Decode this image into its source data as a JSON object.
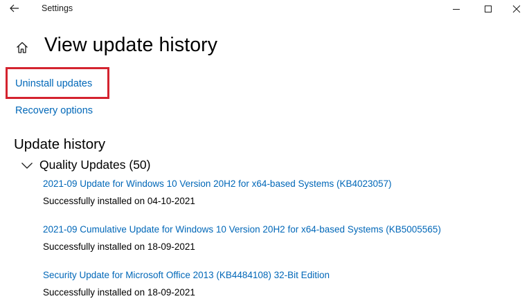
{
  "window": {
    "title": "Settings",
    "controls": {
      "minimize_icon": "minimize-icon",
      "maximize_icon": "maximize-icon",
      "close_icon": "close-icon"
    }
  },
  "header": {
    "title": "View update history",
    "home_icon": "home-icon"
  },
  "links": {
    "uninstall": "Uninstall updates",
    "recovery": "Recovery options"
  },
  "history": {
    "section_title": "Update history",
    "group": {
      "title": "Quality Updates (50)",
      "expanded": true,
      "items": [
        {
          "name": "2021-09 Update for Windows 10 Version 20H2 for x64-based Systems (KB4023057)",
          "status": "Successfully installed on 04-10-2021"
        },
        {
          "name": "2021-09 Cumulative Update for Windows 10 Version 20H2 for x64-based Systems (KB5005565)",
          "status": "Successfully installed on 18-09-2021"
        },
        {
          "name": "Security Update for Microsoft Office 2013 (KB4484108) 32-Bit Edition",
          "status": "Successfully installed on 18-09-2021"
        }
      ]
    }
  },
  "colors": {
    "link": "#0067b8",
    "highlight": "#d4232f",
    "background": "#ffffff",
    "text": "#000000"
  }
}
